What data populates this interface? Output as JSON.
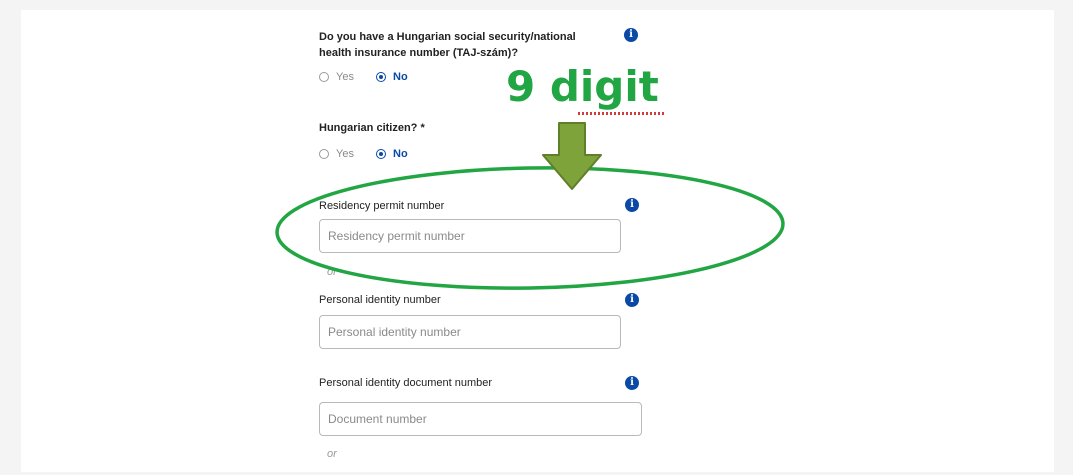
{
  "questions": {
    "taj": {
      "line1": "Do you have a Hungarian social security/national",
      "line2": "health insurance number (TAJ-szám)?",
      "yes_label": "Yes",
      "no_label": "No",
      "selected": "No"
    },
    "citizen": {
      "label": "Hungarian citizen? *",
      "yes_label": "Yes",
      "no_label": "No",
      "selected": "No"
    }
  },
  "fields": {
    "residency": {
      "label": "Residency permit number",
      "placeholder": "Residency permit number",
      "value": ""
    },
    "personal_id": {
      "label": "Personal identity number",
      "placeholder": "Personal identity number",
      "value": ""
    },
    "document": {
      "label": "Personal identity document number",
      "placeholder": "Document number",
      "value": ""
    }
  },
  "separators": {
    "or_1": "or",
    "or_2": "or"
  },
  "info_icon_glyph": "i",
  "annotation": {
    "text": "9 digit",
    "color": "#22a543",
    "arrow_color": "#7ea33a",
    "ellipse_color": "#22a543"
  },
  "colors": {
    "accent": "#0a4aa6",
    "input_border": "#b9b9b9",
    "placeholder": "#8a8a8a",
    "text": "#222222"
  }
}
